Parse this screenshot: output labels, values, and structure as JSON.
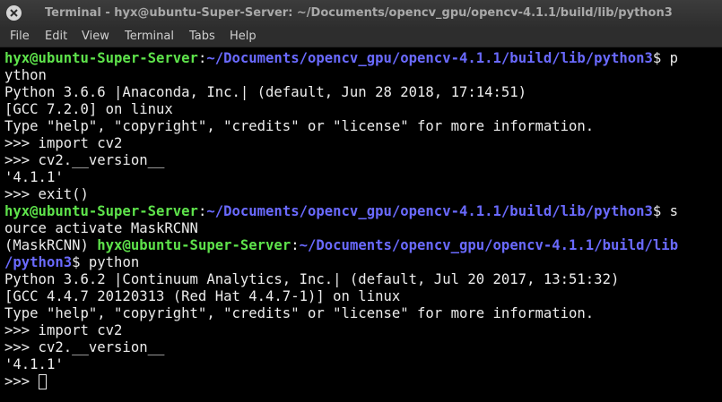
{
  "window": {
    "title": "Terminal - hyx@ubuntu-Super-Server: ~/Documents/opencv_gpu/opencv-4.1.1/build/lib/python3"
  },
  "menu": [
    "File",
    "Edit",
    "View",
    "Terminal",
    "Tabs",
    "Help"
  ],
  "terminal": {
    "lines": [
      {
        "user": "hyx@ubuntu-Super-Server",
        "sep": ":",
        "path": "~/Documents/opencv_gpu/opencv-4.1.1/build/lib/python3",
        "text": "$ p"
      },
      {
        "text": "ython"
      },
      {
        "text": "Python 3.6.6 |Anaconda, Inc.| (default, Jun 28 2018, 17:14:51)"
      },
      {
        "text": "[GCC 7.2.0] on linux"
      },
      {
        "text": "Type \"help\", \"copyright\", \"credits\" or \"license\" for more information."
      },
      {
        "text": ">>> import cv2"
      },
      {
        "text": ">>> cv2.__version__"
      },
      {
        "text": "'4.1.1'"
      },
      {
        "text": ">>> exit()"
      },
      {
        "user": "hyx@ubuntu-Super-Server",
        "sep": ":",
        "path": "~/Documents/opencv_gpu/opencv-4.1.1/build/lib/python3",
        "text": "$ s"
      },
      {
        "text": "ource activate MaskRCNN"
      },
      {
        "prefix": "(MaskRCNN) ",
        "user": "hyx@ubuntu-Super-Server",
        "sep": ":",
        "path": "~/Documents/opencv_gpu/opencv-4.1.1/build/lib",
        "text": ""
      },
      {
        "path": "/python3",
        "text": "$ python"
      },
      {
        "text": "Python 3.6.2 |Continuum Analytics, Inc.| (default, Jul 20 2017, 13:51:32)"
      },
      {
        "text": "[GCC 4.4.7 20120313 (Red Hat 4.4.7-1)] on linux"
      },
      {
        "text": "Type \"help\", \"copyright\", \"credits\" or \"license\" for more information."
      },
      {
        "text": ">>> import cv2"
      },
      {
        "text": ">>> cv2.__version__"
      },
      {
        "text": "'4.1.1'"
      },
      {
        "text": ">>> ",
        "cursor": true
      }
    ]
  },
  "colors": {
    "user": "#5ee34b",
    "path": "#6a6aff",
    "text": "#ececec",
    "background": "#000000"
  },
  "icons": {
    "close": "close-icon"
  }
}
